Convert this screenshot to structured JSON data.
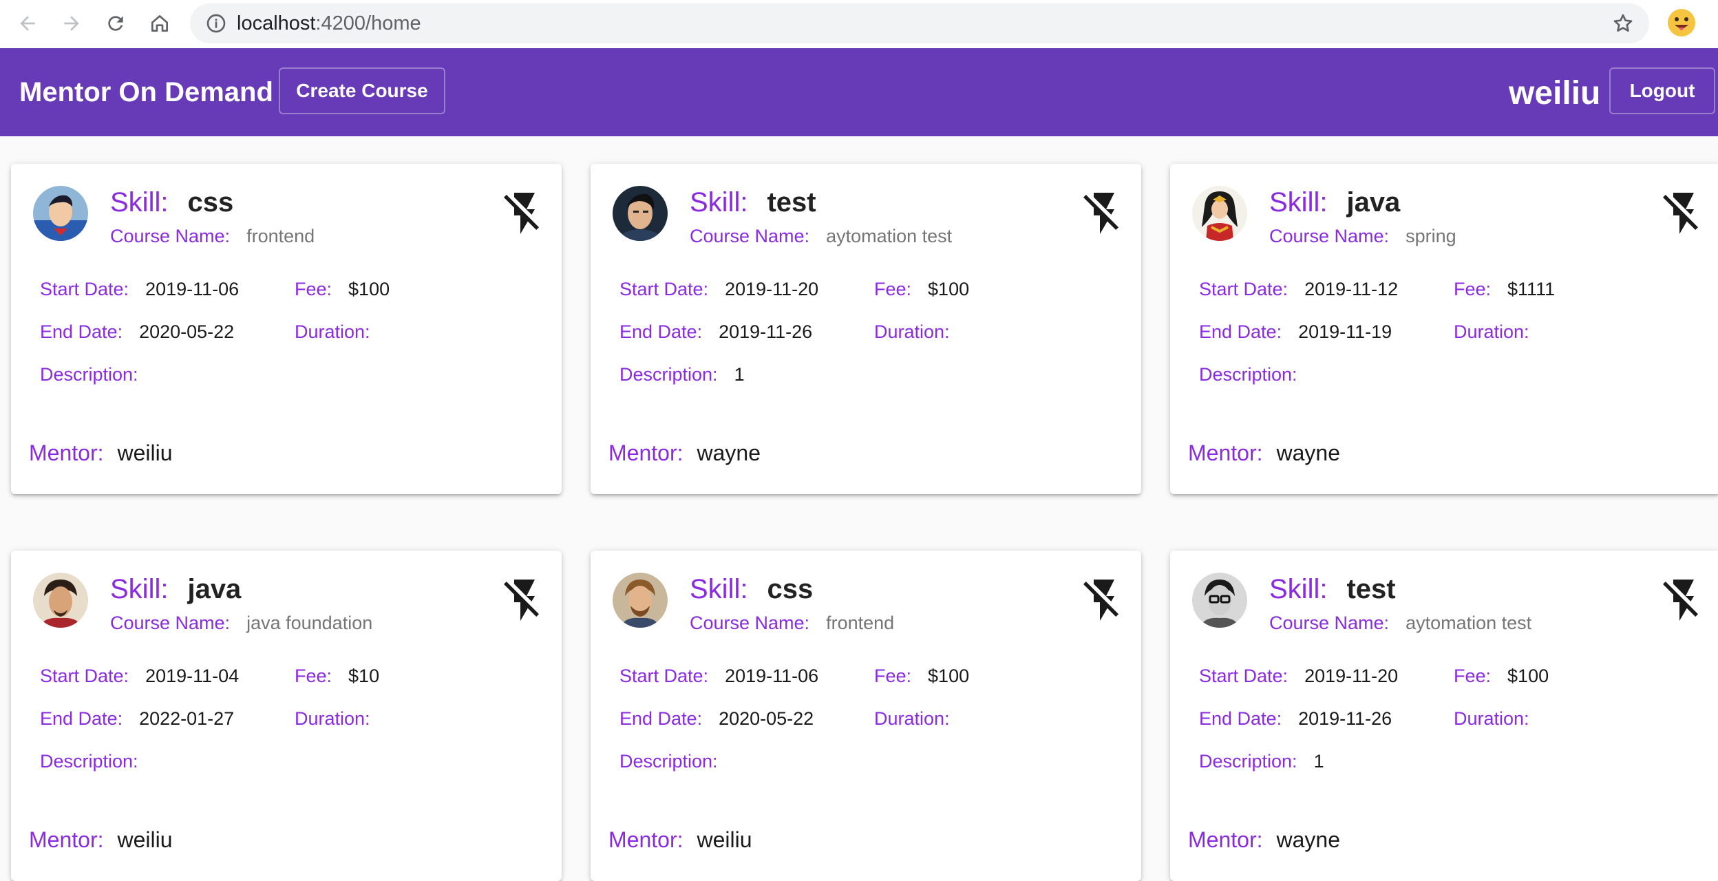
{
  "browser": {
    "url_host": "localhost",
    "url_path": ":4200/home",
    "icons": [
      "back-arrow-icon",
      "forward-arrow-icon",
      "reload-icon",
      "home-icon",
      "info-icon",
      "star-icon",
      "profile-emoji-icon"
    ]
  },
  "toolbar": {
    "brand": "Mentor On Demand",
    "create_label": "Create Course",
    "username": "weiliu",
    "logout_label": "Logout",
    "color": "#673ab7"
  },
  "labels": {
    "skill": "Skill:",
    "course_name": "Course Name:",
    "start_date": "Start Date:",
    "end_date": "End Date:",
    "fee": "Fee:",
    "duration": "Duration:",
    "description": "Description:",
    "mentor": "Mentor:"
  },
  "accent_color": "#8a2be2",
  "cards": [
    {
      "skill": "css",
      "course_name": "frontend",
      "start_date": "2019-11-06",
      "end_date": "2020-05-22",
      "fee": "$100",
      "duration": "",
      "description": "",
      "mentor": "weiliu",
      "avatar": "superman-avatar-icon"
    },
    {
      "skill": "test",
      "course_name": "aytomation test",
      "start_date": "2019-11-20",
      "end_date": "2019-11-26",
      "fee": "$100",
      "duration": "",
      "description": "1",
      "mentor": "wayne",
      "avatar": "batman-avatar-icon"
    },
    {
      "skill": "java",
      "course_name": "spring",
      "start_date": "2019-11-12",
      "end_date": "2019-11-19",
      "fee": "$1111",
      "duration": "",
      "description": "",
      "mentor": "wayne",
      "avatar": "wonder-woman-avatar-icon"
    },
    {
      "skill": "java",
      "course_name": "java foundation",
      "start_date": "2019-11-04",
      "end_date": "2022-01-27",
      "fee": "$10",
      "duration": "",
      "description": "",
      "mentor": "weiliu",
      "avatar": "iron-man-avatar-icon"
    },
    {
      "skill": "css",
      "course_name": "frontend",
      "start_date": "2019-11-06",
      "end_date": "2020-05-22",
      "fee": "$100",
      "duration": "",
      "description": "",
      "mentor": "weiliu",
      "avatar": "captain-avatar-icon"
    },
    {
      "skill": "test",
      "course_name": "aytomation test",
      "start_date": "2019-11-20",
      "end_date": "2019-11-26",
      "fee": "$100",
      "duration": "",
      "description": "1",
      "mentor": "wayne",
      "avatar": "glasses-man-avatar-icon"
    }
  ]
}
